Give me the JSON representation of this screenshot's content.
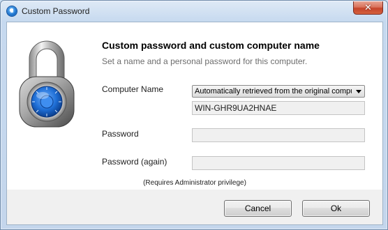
{
  "window": {
    "title": "Custom Password",
    "close_symbol": "✕"
  },
  "main": {
    "heading": "Custom password and custom computer name",
    "subheading": "Set a name and a personal password for this computer."
  },
  "form": {
    "computer_name_label": "Computer Name",
    "computer_name_option": "Automatically retrieved from the original computer",
    "computer_name_value": "WIN-GHR9UA2HNAE",
    "password_label": "Password",
    "password_value": "",
    "password_again_label": "Password (again)",
    "password_again_value": "",
    "note": "(Requires Administrator privilege)"
  },
  "buttons": {
    "cancel": "Cancel",
    "ok": "Ok"
  },
  "colors": {
    "lock_dial": "#1f6fd6",
    "close_button": "#c5442a"
  }
}
